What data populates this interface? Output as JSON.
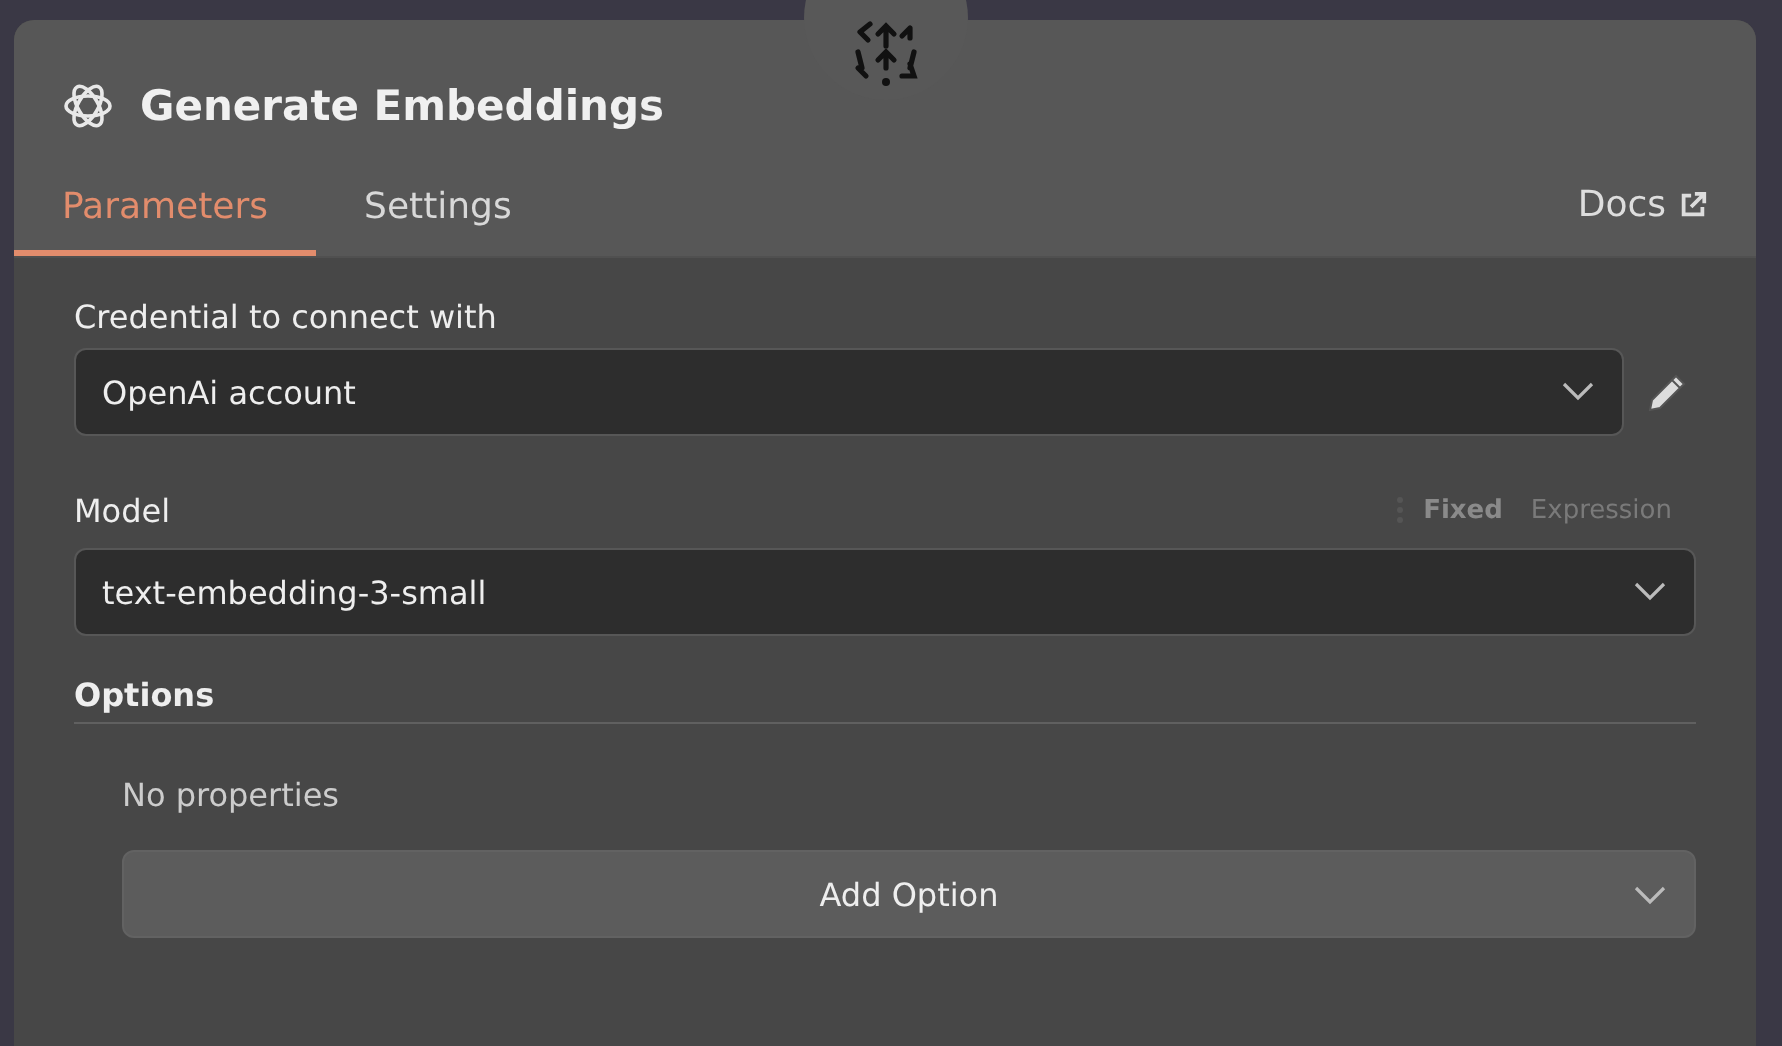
{
  "node": {
    "title": "Generate Embeddings"
  },
  "tabs": [
    {
      "label": "Parameters",
      "selected": true
    },
    {
      "label": "Settings",
      "selected": false
    }
  ],
  "docs": {
    "label": "Docs"
  },
  "credential": {
    "label": "Credential to connect with",
    "value": "OpenAi account"
  },
  "model": {
    "label": "Model",
    "value": "text-embedding-3-small",
    "modes": [
      {
        "label": "Fixed",
        "selected": true
      },
      {
        "label": "Expression",
        "selected": false
      }
    ]
  },
  "options": {
    "title": "Options",
    "empty_text": "No properties",
    "add_button": "Add Option"
  }
}
